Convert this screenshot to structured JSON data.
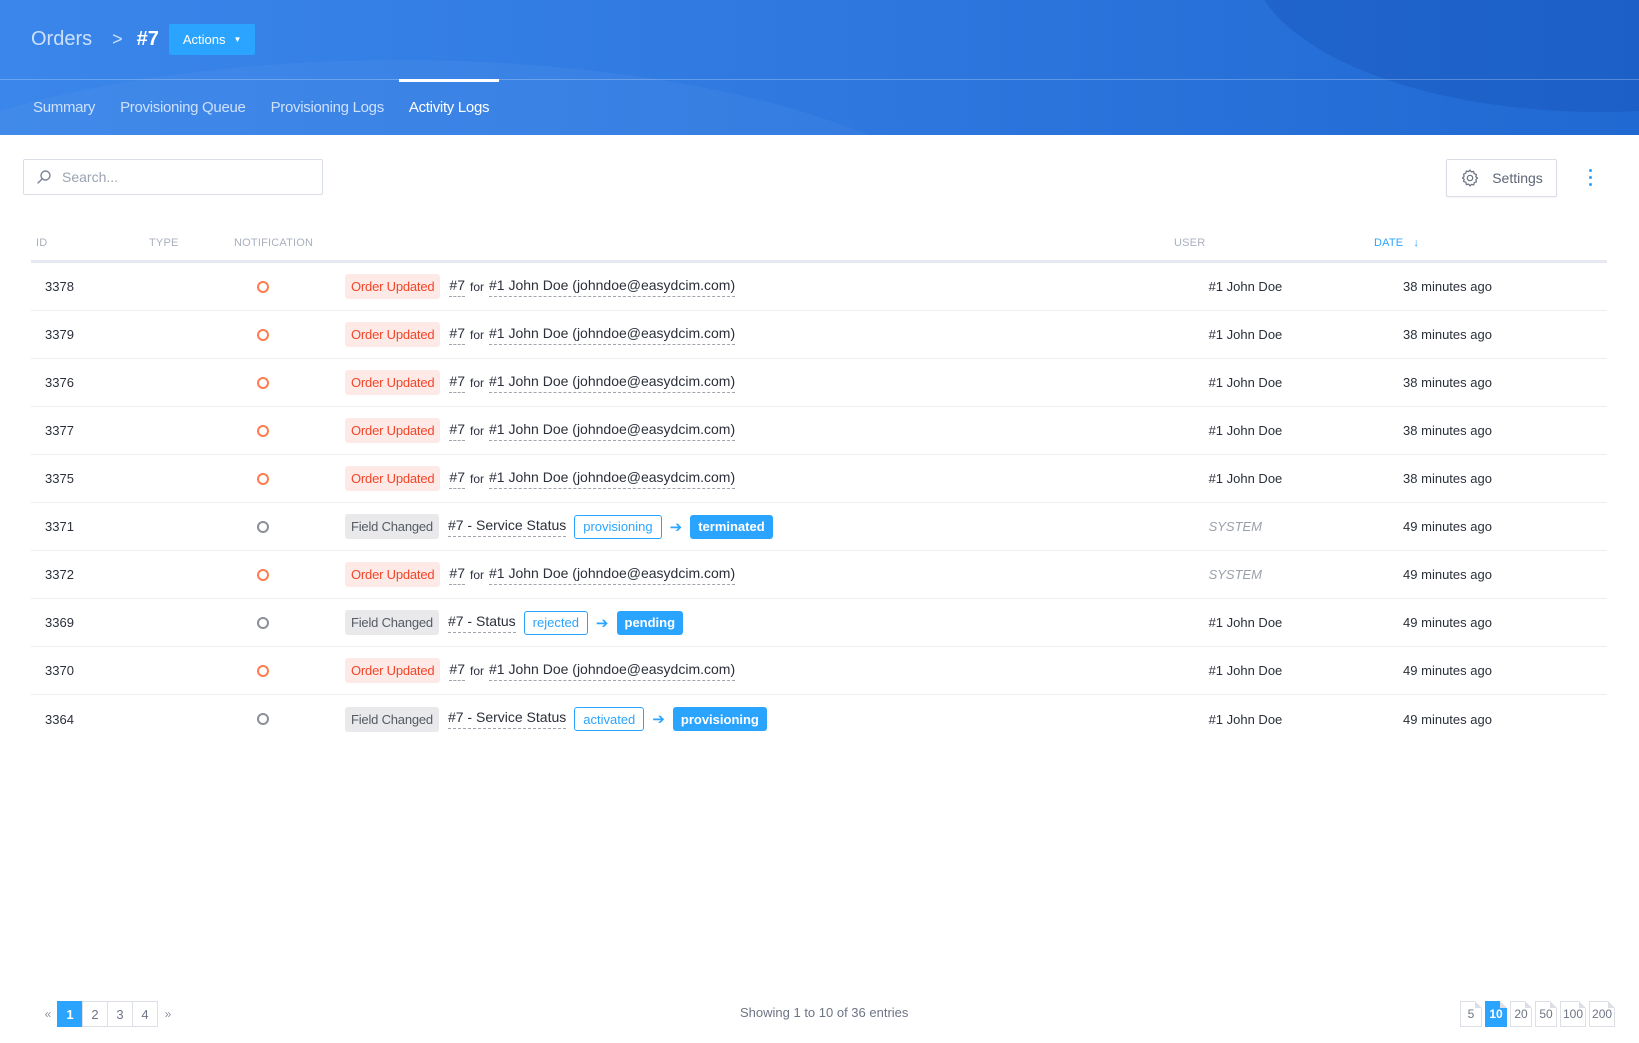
{
  "header": {
    "breadcrumb": {
      "root": "Orders",
      "separator": ">",
      "current": "#7"
    },
    "actions_label": "Actions",
    "tabs": [
      {
        "label": "Summary",
        "active": false
      },
      {
        "label": "Provisioning Queue",
        "active": false
      },
      {
        "label": "Provisioning Logs",
        "active": false
      },
      {
        "label": "Activity Logs",
        "active": true
      }
    ]
  },
  "toolbar": {
    "search_placeholder": "Search...",
    "search_value": "",
    "settings_label": "Settings"
  },
  "table": {
    "columns": {
      "id": "ID",
      "type": "TYPE",
      "notification": "NOTIFICATION",
      "user": "USER",
      "date": "DATE",
      "sort_icon": "↓"
    },
    "rows": [
      {
        "id": "3378",
        "kind": "order",
        "badge": "Order Updated",
        "ref": "#7",
        "for": "for",
        "target": "#1 John Doe (johndoe@easydcim.com)",
        "user": "#1 John Doe",
        "system": false,
        "date": "38 minutes ago"
      },
      {
        "id": "3379",
        "kind": "order",
        "badge": "Order Updated",
        "ref": "#7",
        "for": "for",
        "target": "#1 John Doe (johndoe@easydcim.com)",
        "user": "#1 John Doe",
        "system": false,
        "date": "38 minutes ago"
      },
      {
        "id": "3376",
        "kind": "order",
        "badge": "Order Updated",
        "ref": "#7",
        "for": "for",
        "target": "#1 John Doe (johndoe@easydcim.com)",
        "user": "#1 John Doe",
        "system": false,
        "date": "38 minutes ago"
      },
      {
        "id": "3377",
        "kind": "order",
        "badge": "Order Updated",
        "ref": "#7",
        "for": "for",
        "target": "#1 John Doe (johndoe@easydcim.com)",
        "user": "#1 John Doe",
        "system": false,
        "date": "38 minutes ago"
      },
      {
        "id": "3375",
        "kind": "order",
        "badge": "Order Updated",
        "ref": "#7",
        "for": "for",
        "target": "#1 John Doe (johndoe@easydcim.com)",
        "user": "#1 John Doe",
        "system": false,
        "date": "38 minutes ago"
      },
      {
        "id": "3371",
        "kind": "field",
        "badge": "Field Changed",
        "field": "#7 - Service Status",
        "old": "provisioning",
        "arrow": "➔",
        "new": "terminated",
        "user": "SYSTEM",
        "system": true,
        "date": "49 minutes ago"
      },
      {
        "id": "3372",
        "kind": "order",
        "badge": "Order Updated",
        "ref": "#7",
        "for": "for",
        "target": "#1 John Doe (johndoe@easydcim.com)",
        "user": "SYSTEM",
        "system": true,
        "date": "49 minutes ago"
      },
      {
        "id": "3369",
        "kind": "field",
        "badge": "Field Changed",
        "field": "#7 - Status",
        "old": "rejected",
        "arrow": "➔",
        "new": "pending",
        "user": "#1 John Doe",
        "system": false,
        "date": "49 minutes ago"
      },
      {
        "id": "3370",
        "kind": "order",
        "badge": "Order Updated",
        "ref": "#7",
        "for": "for",
        "target": "#1 John Doe (johndoe@easydcim.com)",
        "user": "#1 John Doe",
        "system": false,
        "date": "49 minutes ago"
      },
      {
        "id": "3364",
        "kind": "field",
        "badge": "Field Changed",
        "field": "#7 - Service Status",
        "old": "activated",
        "arrow": "➔",
        "new": "provisioning",
        "user": "#1 John Doe",
        "system": false,
        "date": "49 minutes ago"
      }
    ]
  },
  "footer": {
    "prev_icon": "«",
    "next_icon": "»",
    "pages": [
      "1",
      "2",
      "3",
      "4"
    ],
    "current_page": "1",
    "showing": "Showing 1 to 10 of 36 entries",
    "page_sizes": [
      "5",
      "10",
      "20",
      "50",
      "100",
      "200"
    ],
    "current_size": "10"
  },
  "colors": {
    "accent": "#2ba4ff",
    "header_bg": "#2e78e0",
    "order_badge_bg": "#fdeae6",
    "order_badge_text": "#f2452a",
    "field_badge_bg": "#e9e9eb",
    "type_order": "#ff7d4d",
    "type_field": "#8a8f99"
  }
}
